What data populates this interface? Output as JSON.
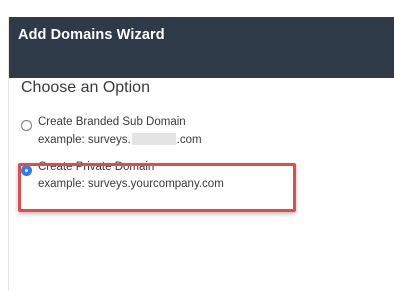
{
  "wizard": {
    "title": "Add Domains Wizard",
    "section_title": "Choose an Option",
    "options": [
      {
        "label": "Create Branded Sub Domain",
        "example_prefix": "example: surveys.",
        "example_suffix": ".com",
        "selected": false
      },
      {
        "label": "Create Private Domain",
        "example": "example: surveys.yourcompany.com",
        "selected": true
      }
    ]
  },
  "colors": {
    "header_bg": "#2f3a48",
    "radio_selected": "#2f7bef",
    "highlight_border": "#e04b4b"
  }
}
